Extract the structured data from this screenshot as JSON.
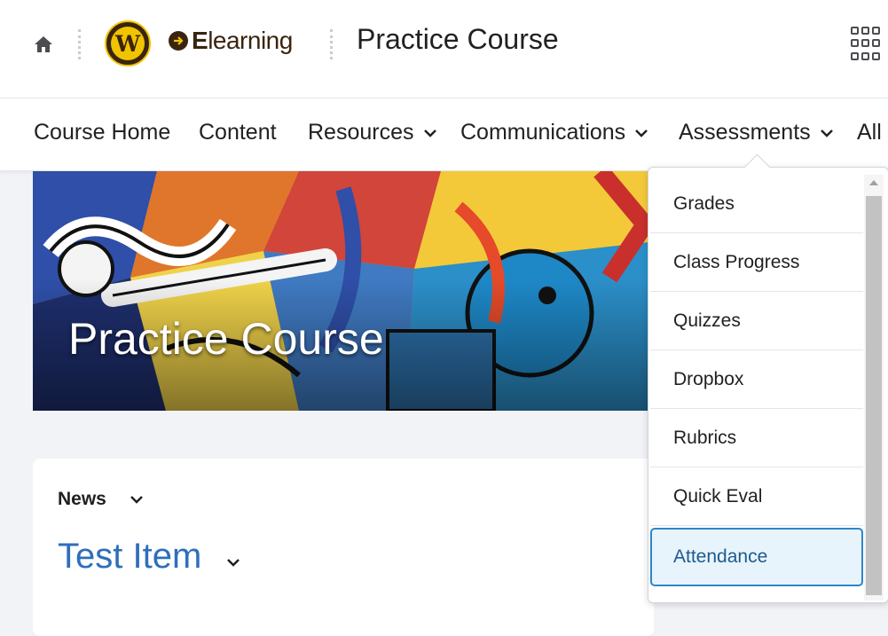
{
  "header": {
    "brand_logo_letter": "W",
    "brand_name": "Elearning",
    "site_title": "Practice Course"
  },
  "nav": {
    "items": [
      {
        "label": "Course Home",
        "has_menu": false
      },
      {
        "label": "Content",
        "has_menu": false
      },
      {
        "label": "Resources",
        "has_menu": true
      },
      {
        "label": "Communications",
        "has_menu": true
      },
      {
        "label": "Assessments",
        "has_menu": true
      },
      {
        "label": "All",
        "has_menu": false
      }
    ]
  },
  "banner": {
    "title": "Practice Course"
  },
  "news": {
    "header": "News",
    "item_title": "Test Item"
  },
  "assessments_menu": {
    "items": [
      {
        "label": "Grades"
      },
      {
        "label": "Class Progress"
      },
      {
        "label": "Quizzes"
      },
      {
        "label": "Dropbox"
      },
      {
        "label": "Rubrics"
      },
      {
        "label": "Quick Eval"
      },
      {
        "label": "Attendance",
        "active": true
      }
    ]
  },
  "colors": {
    "brand_brown": "#3a2410",
    "brand_gold": "#f1c400",
    "link_blue": "#2e6fbb",
    "active_border": "#2e86c8"
  }
}
